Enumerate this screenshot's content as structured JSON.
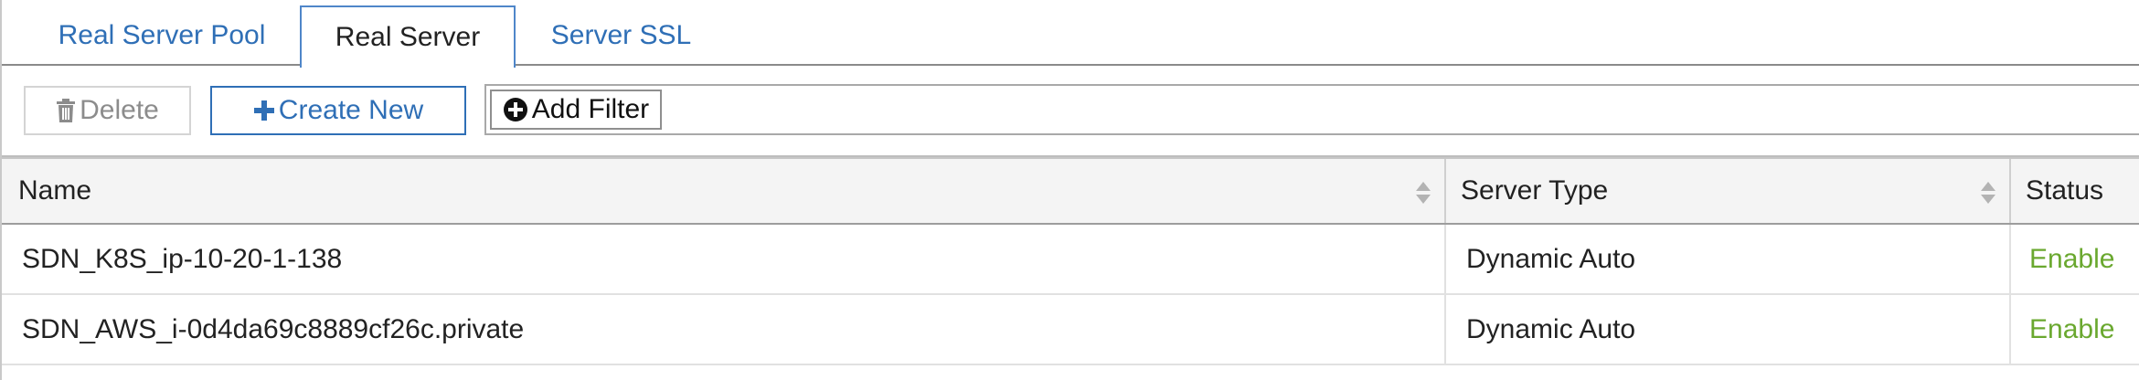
{
  "tabs": [
    {
      "label": "Real Server Pool",
      "active": false
    },
    {
      "label": "Real Server",
      "active": true
    },
    {
      "label": "Server SSL",
      "active": false
    }
  ],
  "toolbar": {
    "delete_label": "Delete",
    "delete_icon": "trash-icon",
    "create_label": "Create New",
    "create_icon": "plus-icon",
    "add_filter_label": "Add Filter",
    "add_filter_icon": "plus-circle-icon"
  },
  "table": {
    "columns": [
      "Name",
      "Server Type",
      "Status"
    ],
    "sort_icon": "sort-icon",
    "rows": [
      {
        "name": "SDN_K8S_ip-10-20-1-138",
        "server_type": "Dynamic Auto",
        "status": "Enable"
      },
      {
        "name": "SDN_AWS_i-0d4da69c8889cf26c.private",
        "server_type": "Dynamic Auto",
        "status": "Enable"
      }
    ]
  },
  "colors": {
    "link_blue": "#2f6fb6",
    "status_green": "#6aa82f",
    "disabled_gray": "#8c8c8c"
  }
}
